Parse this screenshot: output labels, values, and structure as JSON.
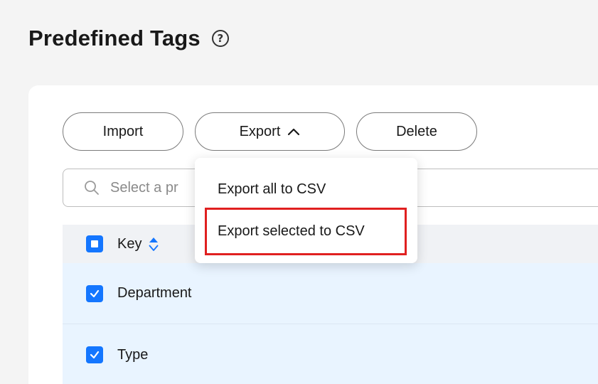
{
  "header": {
    "title": "Predefined Tags",
    "help_icon": "question-circle-icon"
  },
  "toolbar": {
    "import_label": "Import",
    "export_label": "Export",
    "delete_label": "Delete"
  },
  "search": {
    "placeholder": "Select a pr"
  },
  "export_menu": {
    "items": [
      {
        "label": "Export all to CSV"
      },
      {
        "label": "Export selected to CSV",
        "highlighted": true
      }
    ],
    "highlight_color": "#e02020"
  },
  "table": {
    "columns": [
      {
        "label": "Key",
        "sortable": true
      }
    ],
    "rows": [
      {
        "key": "Department",
        "selected": true
      },
      {
        "key": "Type",
        "selected": true
      }
    ]
  },
  "colors": {
    "accent": "#1476ff",
    "selected_row": "#e9f4ff",
    "header_row": "#f0f2f5"
  }
}
